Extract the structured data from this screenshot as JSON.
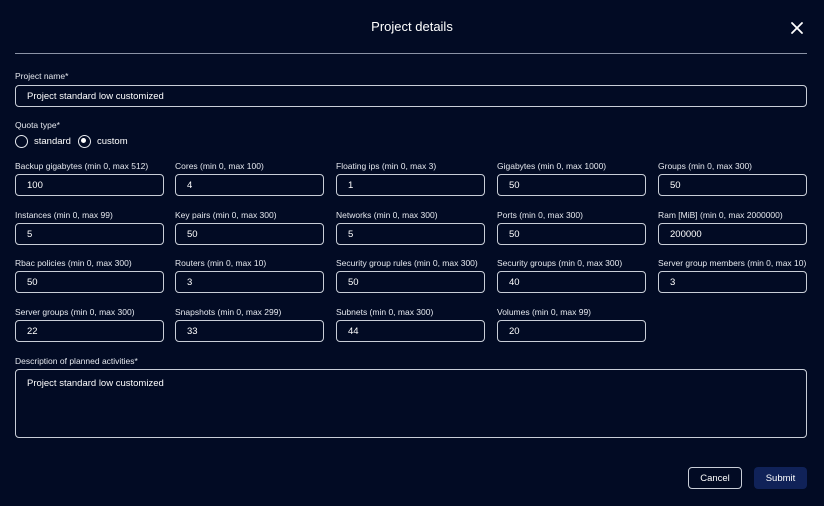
{
  "dialog": {
    "title": "Project details",
    "close_icon": "close-icon"
  },
  "project_name": {
    "label": "Project name*",
    "value": "Project standard low customized"
  },
  "quota_type": {
    "label": "Quota type*",
    "options": [
      {
        "label": "standard",
        "checked": false
      },
      {
        "label": "custom",
        "checked": true
      }
    ]
  },
  "quotas": [
    {
      "label": "Backup gigabytes (min 0, max 512)",
      "value": "100"
    },
    {
      "label": "Cores (min 0, max 100)",
      "value": "4"
    },
    {
      "label": "Floating ips (min 0, max 3)",
      "value": "1"
    },
    {
      "label": "Gigabytes (min 0, max 1000)",
      "value": "50"
    },
    {
      "label": "Groups (min 0, max 300)",
      "value": "50"
    },
    {
      "label": "Instances (min 0, max 99)",
      "value": "5"
    },
    {
      "label": "Key pairs (min 0, max 300)",
      "value": "50"
    },
    {
      "label": "Networks (min 0, max 300)",
      "value": "5"
    },
    {
      "label": "Ports (min 0, max 300)",
      "value": "50"
    },
    {
      "label": "Ram [MiB] (min 0, max 2000000)",
      "value": "200000"
    },
    {
      "label": "Rbac policies (min 0, max 300)",
      "value": "50"
    },
    {
      "label": "Routers (min 0, max 10)",
      "value": "3"
    },
    {
      "label": "Security group rules (min 0, max 300)",
      "value": "50"
    },
    {
      "label": "Security groups (min 0, max 300)",
      "value": "40"
    },
    {
      "label": "Server group members (min 0, max 10)",
      "value": "3"
    },
    {
      "label": "Server groups (min 0, max 300)",
      "value": "22"
    },
    {
      "label": "Snapshots (min 0, max 299)",
      "value": "33"
    },
    {
      "label": "Subnets (min 0, max 300)",
      "value": "44"
    },
    {
      "label": "Volumes (min 0, max 99)",
      "value": "20"
    }
  ],
  "description": {
    "label": "Description of planned activities*",
    "value": "Project standard low customized"
  },
  "actions": {
    "cancel_label": "Cancel",
    "submit_label": "Submit"
  },
  "colors": {
    "background": "#020b24",
    "submit": "#102258",
    "border": "#c9ced8"
  }
}
